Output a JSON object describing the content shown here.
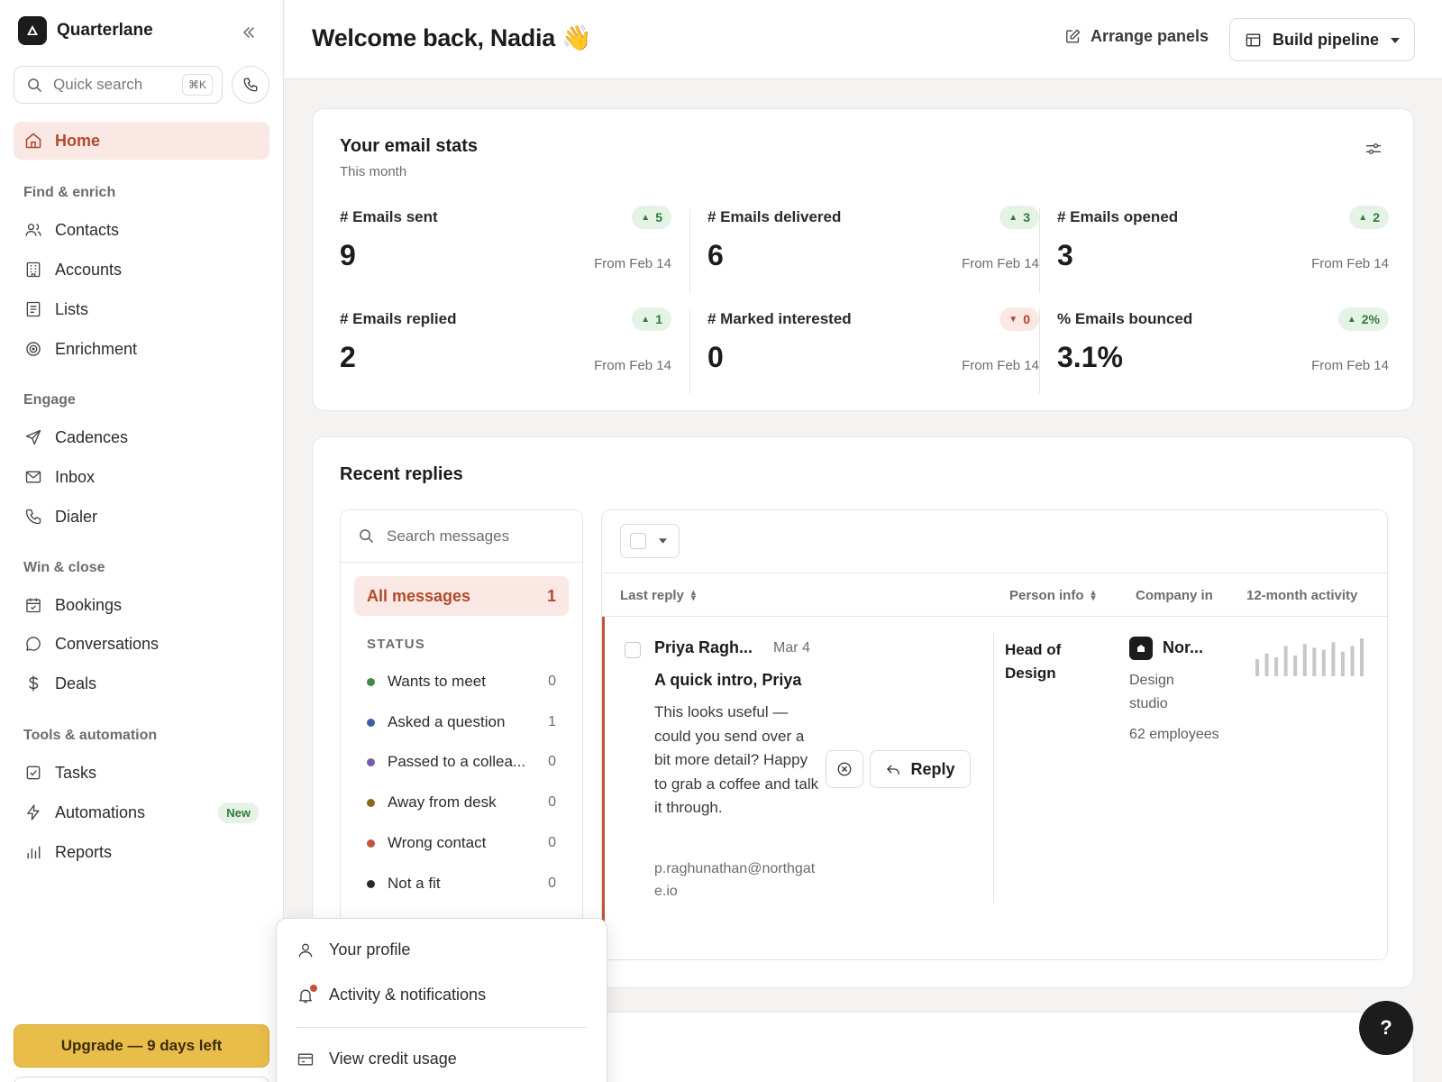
{
  "sidebar": {
    "brand": "Quarterlane",
    "search": {
      "placeholder": "Quick search",
      "shortcut": "⌘K"
    },
    "home": "Home",
    "sections": [
      {
        "title": "Find & enrich",
        "items": [
          {
            "label": "Contacts",
            "icon": "users-icon"
          },
          {
            "label": "Accounts",
            "icon": "building-icon"
          },
          {
            "label": "Lists",
            "icon": "list-icon"
          },
          {
            "label": "Enrichment",
            "icon": "target-icon"
          }
        ]
      },
      {
        "title": "Engage",
        "items": [
          {
            "label": "Cadences",
            "icon": "send-icon"
          },
          {
            "label": "Inbox",
            "icon": "mail-icon"
          },
          {
            "label": "Dialer",
            "icon": "phone-icon"
          }
        ]
      },
      {
        "title": "Win & close",
        "items": [
          {
            "label": "Bookings",
            "icon": "calendar-icon"
          },
          {
            "label": "Conversations",
            "icon": "chat-icon"
          },
          {
            "label": "Deals",
            "icon": "dollar-icon"
          }
        ]
      },
      {
        "title": "Tools & automation",
        "items": [
          {
            "label": "Tasks",
            "icon": "checkbox-icon"
          },
          {
            "label": "Automations",
            "icon": "bolt-icon",
            "badge": "New"
          },
          {
            "label": "Reports",
            "icon": "bar-chart-icon"
          }
        ]
      }
    ],
    "upgrade": "Upgrade — 9 days left"
  },
  "header": {
    "welcome": "Welcome back, Nadia 👋",
    "arrange": "Arrange panels",
    "build": "Build pipeline"
  },
  "email_stats": {
    "title": "Your email stats",
    "subtitle": "This month",
    "stats": [
      {
        "name": "# Emails sent",
        "value": "9",
        "delta": "5",
        "direction": "up",
        "from": "From Feb 14"
      },
      {
        "name": "# Emails delivered",
        "value": "6",
        "delta": "3",
        "direction": "up",
        "from": "From Feb 14"
      },
      {
        "name": "# Emails opened",
        "value": "3",
        "delta": "2",
        "direction": "up",
        "from": "From Feb 14"
      },
      {
        "name": "# Emails replied",
        "value": "2",
        "delta": "1",
        "direction": "up",
        "from": "From Feb 14"
      },
      {
        "name": "# Marked interested",
        "value": "0",
        "delta": "0",
        "direction": "down",
        "from": "From Feb 14"
      },
      {
        "name": "% Emails bounced",
        "value": "3.1%",
        "delta": "2%",
        "direction": "up",
        "from": "From Feb 14"
      }
    ]
  },
  "recent_replies": {
    "title": "Recent replies",
    "search_placeholder": "Search messages",
    "all_messages": {
      "label": "All messages",
      "count": "1"
    },
    "status_heading": "STATUS",
    "statuses": [
      {
        "label": "Wants to meet",
        "count": "0",
        "color": "#3b8a4a"
      },
      {
        "label": "Asked a question",
        "count": "1",
        "color": "#3f5fa8"
      },
      {
        "label": "Passed to a collea...",
        "count": "0",
        "color": "#7a5bb0"
      },
      {
        "label": "Away from desk",
        "count": "0",
        "color": "#8a6a22"
      },
      {
        "label": "Wrong contact",
        "count": "0",
        "color": "#c0553a"
      },
      {
        "label": "Not a fit",
        "count": "0",
        "color": "#2b2b2b"
      }
    ],
    "columns": {
      "last_reply": "Last reply",
      "person_info": "Person info",
      "company_info": "Company in",
      "activity": "12-month activity"
    },
    "message": {
      "sender": "Priya Ragh...",
      "date": "Mar 4",
      "subject": "A quick intro, Priya",
      "body": "This looks useful — could you send over a bit more detail? Happy to grab a coffee and talk it through.",
      "email": "p.raghunathan@northgate.io",
      "reply_label": "Reply",
      "person_title": "Head of Design",
      "company_name": "Nor...",
      "company_type": "Design studio",
      "company_size": "62 employees",
      "activity": [
        0.45,
        0.6,
        0.5,
        0.8,
        0.55,
        0.85,
        0.75,
        0.7,
        0.9,
        0.65,
        0.8,
        1.0
      ]
    }
  },
  "user_menu": {
    "items": [
      "Your profile",
      "Activity & notifications",
      "View credit usage"
    ]
  },
  "help": "?",
  "colors": {
    "accent": "#b24a2c",
    "accent_bg": "#f9e8e3",
    "upgrade": "#e9bd4a",
    "up": "#2f7d3a",
    "down": "#b4432c"
  }
}
